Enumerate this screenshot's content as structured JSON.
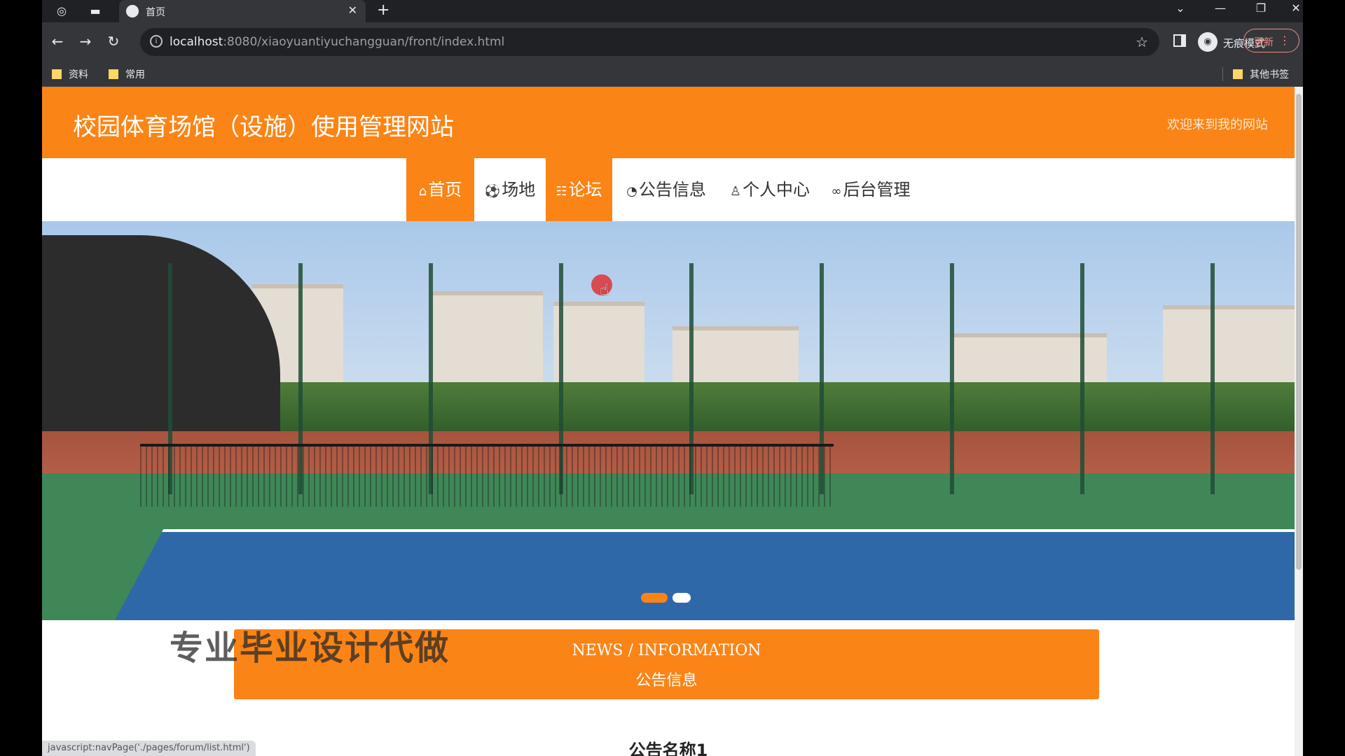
{
  "browser": {
    "tab_title": "首页",
    "new_tab": "+",
    "url_host": "localhost",
    "url_path": ":8080/xiaoyuantiyuchangguan/front/index.html",
    "incognito_label": "无痕模式",
    "update_label": "更新",
    "bookmarks": [
      "资料",
      "常用"
    ],
    "other_bookmarks": "其他书签",
    "status_url": "javascript:navPage('./pages/forum/list.html')"
  },
  "site": {
    "title": "校园体育场馆（设施）使用管理网站",
    "welcome": "欢迎来到我的网站",
    "nav": [
      {
        "label": "首页",
        "icon": "home-icon",
        "active": true
      },
      {
        "label": "场地",
        "icon": "soccer-icon",
        "active": false
      },
      {
        "label": "论坛",
        "icon": "forum-icon",
        "active": true
      },
      {
        "label": "公告信息",
        "icon": "notice-icon",
        "active": false
      },
      {
        "label": "个人中心",
        "icon": "user-icon",
        "active": false
      },
      {
        "label": "后台管理",
        "icon": "link-icon",
        "active": false
      }
    ],
    "watermark": "专业毕业设计代做",
    "news_en": "NEWS / INFORMATION",
    "news_cn": "公告信息",
    "first_notice": "公告名称1"
  },
  "colors": {
    "brand": "#fb8416"
  },
  "carousel": {
    "slides": 2,
    "active_index": 0
  }
}
